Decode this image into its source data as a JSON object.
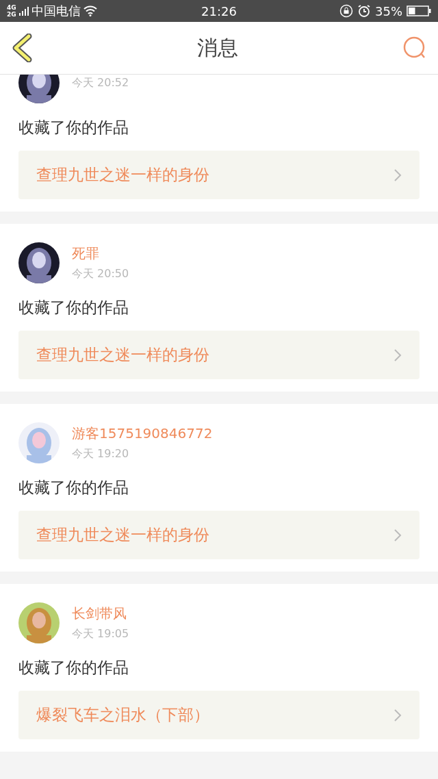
{
  "status_bar": {
    "network_top": "4G",
    "network_bottom": "2G",
    "carrier": "中国电信",
    "time": "21:26",
    "battery_text": "35%"
  },
  "header": {
    "title": "消息"
  },
  "messages": [
    {
      "time": "今天 20:52",
      "action": "收藏了你的作品",
      "work": "查理九世之迷一样的身份"
    },
    {
      "name": "死罪",
      "time": "今天 20:50",
      "action": "收藏了你的作品",
      "work": "查理九世之迷一样的身份"
    },
    {
      "name": "游客1575190846772",
      "time": "今天 19:20",
      "action": "收藏了你的作品",
      "work": "查理九世之迷一样的身份"
    },
    {
      "name": "长剑带风",
      "time": "今天 19:05",
      "action": "收藏了你的作品",
      "work": "爆裂飞车之泪水（下部）"
    }
  ]
}
